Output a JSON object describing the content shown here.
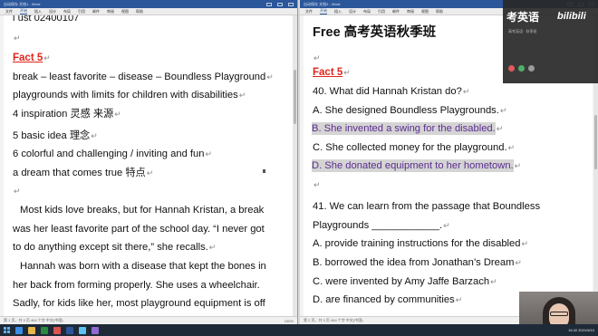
{
  "left_window": {
    "titlebar_text": "自动保存  文档1 - Word",
    "ribbon": [
      "文件",
      "开始",
      "插入",
      "设计",
      "布局",
      "引用",
      "邮件",
      "审阅",
      "视图",
      "帮助"
    ],
    "status_text": "第 1 页，共 3 页  464 个字  中文(中国)",
    "zoom_text": "100%",
    "lines": {
      "top_partial": "l ust 02400107",
      "fact": "Fact 5",
      "l1": "break – least favorite – disease – Boundless Playground",
      "l2": "playgrounds with limits for children with disabilities",
      "l3": "4 inspiration  灵感  来源",
      "l4": "5 basic idea  理念",
      "l5": "6 colorful and challenging / inviting and fun",
      "l6": "a dream that comes true  特点",
      "p1a": "Most kids love breaks, but for Hannah Kristan, a break",
      "p1b": "was her least favorite part of the school day. “I never got",
      "p1c": "to do anything except sit there,” she recalls.",
      "p2a": "Hannah was born with a disease that kept the bones in",
      "p2b": "her back from forming properly. She uses a wheelchair.",
      "p2c": "Sadly, for kids like her, most playground equipment is off"
    }
  },
  "right_window": {
    "titlebar_text": "自动保存  文档2 - Word",
    "ribbon": [
      "文件",
      "开始",
      "插入",
      "设计",
      "布局",
      "引用",
      "邮件",
      "审阅",
      "视图",
      "帮助"
    ],
    "status_text": "第 2 页，共 3 页  464 个字  中文(中国)",
    "zoom_text": "100%",
    "lines": {
      "heading_en": "Free",
      "heading_cn": "高考英语秋季班",
      "fact": "Fact 5",
      "q40": "40. What did Hannah Kristan do?",
      "q40a": "A. She designed Boundless Playgrounds.",
      "q40b": "B. She invented a swing for the disabled.",
      "q40c": "C. She collected money for the playground.",
      "q40d": "D. She donated equipment to her hometown.",
      "q41a": "41. We  can  learn  from  the  passage  that  Boundless",
      "q41b": "Playgrounds ____________.",
      "q41A": "A. provide training instructions for the disabled",
      "q41B": "B. borrowed the idea from Jonathan’s Dream",
      "q41C": "C. were invented by Amy Jaffe Barzach",
      "q41D": "D. are financed by communities"
    }
  },
  "overlay": {
    "brand": "考英语",
    "logo": "bilibili",
    "sub": "高考英语 · 秋季班"
  },
  "taskbar": {
    "clock": "19:42  2021/9/10"
  },
  "colors": {
    "fact_red": "#e0241b",
    "selection_bg": "#d4d4d4",
    "selection_text": "#5b2c8f",
    "word_blue": "#2b579a"
  }
}
